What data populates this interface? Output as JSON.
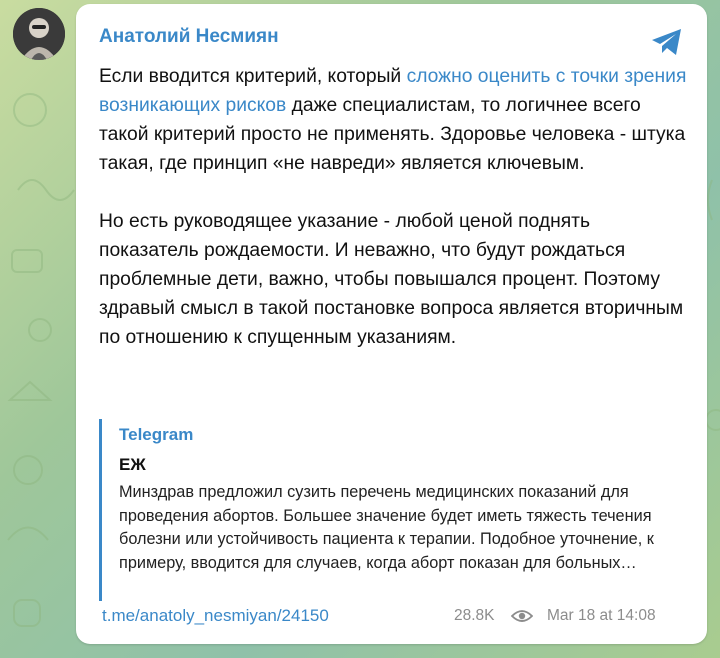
{
  "post": {
    "author": "Анатолий Несмиян",
    "paragraph1": {
      "before": "Если вводится критерий, который ",
      "link": "сложно оценить с точки зрения возникающих рисков",
      "after": " даже специалистам, то логичнее всего такой критерий просто не применять. Здоровье человека - штука такая, где принцип «не навреди» является ключевым."
    },
    "paragraph2": "Но есть руководящее указание - любой ценой поднять показатель рождаемости. И неважно, что будут рождаться проблемные дети, важно, чтобы повышался процент. Поэтому здравый смысл в такой постановке вопроса является вторичным по отношению к спущенным указаниям.",
    "quote": {
      "source": "Telegram",
      "title": "ЕЖ",
      "text": "Минздрав предложил сузить перечень медицинских показаний для проведения абортов. Большее значение будет иметь тяжесть течения болезни или устойчивость пациента к терапии. Подобное уточнение, к примеру, вводится для случаев, когда аборт показан для больных…"
    },
    "link": "t.me/anatoly_nesmiyan/24150",
    "views": "28.8K",
    "date": "Mar 18 at 14:08"
  },
  "icons": {
    "share": "telegram-plane-icon",
    "views": "eye-icon",
    "avatar": "author-avatar"
  },
  "colors": {
    "accent": "#3a88c8",
    "meta": "#8c8c8c",
    "bubble": "#ffffff"
  }
}
